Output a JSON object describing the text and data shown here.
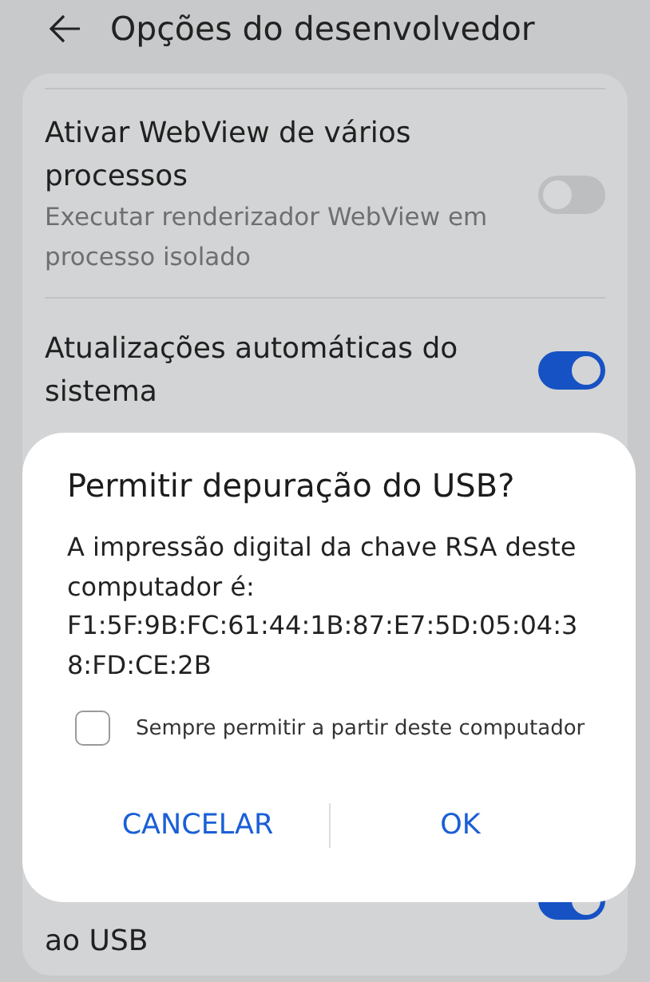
{
  "header": {
    "title": "Opções do desenvolvedor"
  },
  "settings": [
    {
      "title": "Ativar WebView de vários processos",
      "subtitle": "Executar renderizador WebView em processo isolado",
      "on": false
    },
    {
      "title": "Atualizações automáticas do sistema",
      "on": true
    },
    {
      "title": "ao USB",
      "on": true
    }
  ],
  "dialog": {
    "title": "Permitir depuração do USB?",
    "message": "A impressão digital da chave RSA deste computador é: F1:5F:9B:FC:61:44:1B:87:E7:5D:05:04:38:FD:CE:2B",
    "checkbox": {
      "label": "Sempre permitir a partir deste computador",
      "checked": false
    },
    "buttons": [
      "CANCELAR",
      "OK"
    ]
  }
}
